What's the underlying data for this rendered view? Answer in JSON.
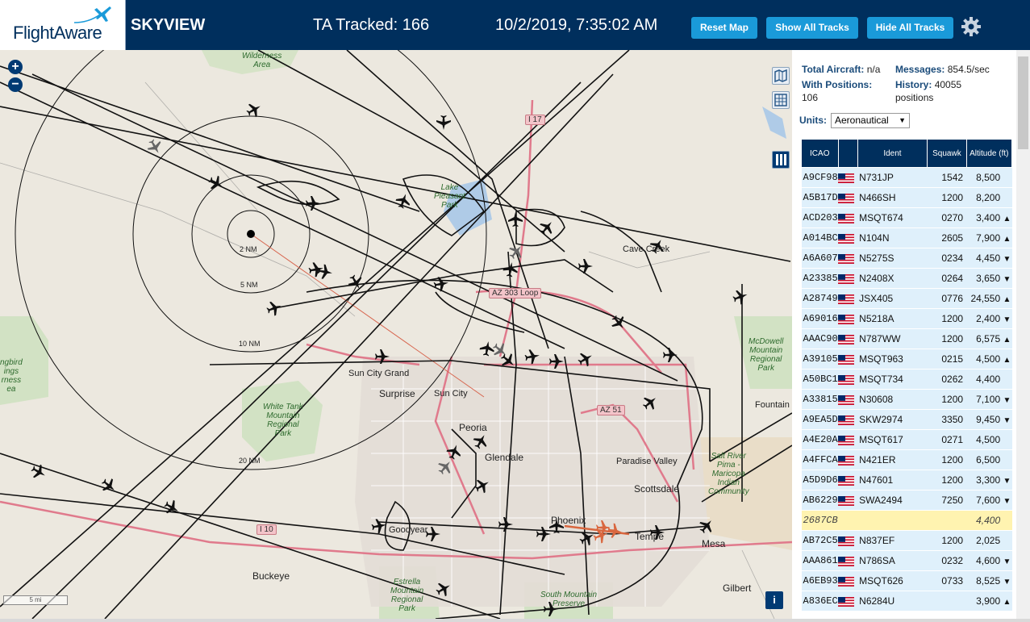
{
  "header": {
    "logo": "FlightAware",
    "app_title": "SKYVIEW",
    "ta_tracked": "TA Tracked: 166",
    "datetime": "10/2/2019, 7:35:02 AM",
    "buttons": {
      "reset": "Reset Map",
      "show_all": "Show All Tracks",
      "hide_all": "Hide All Tracks"
    },
    "settings_icon": "gear-icon"
  },
  "map": {
    "zoom_in": "+",
    "zoom_out": "−",
    "range_rings": [
      "2 NM",
      "5 NM",
      "10 NM",
      "20 NM"
    ],
    "labels": {
      "wilderness": "Wilderness\nArea",
      "cave_creek": "Cave Creek",
      "sun_city_grand": "Sun City Grand",
      "surprise": "Surprise",
      "sun_city": "Sun City",
      "peoria": "Peoria",
      "glendale": "Glendale",
      "paradise_valley": "Paradise Valley",
      "scottsdale": "Scottsdale",
      "phoenix": "Phoenix",
      "tempe": "Tempe",
      "mesa": "Mesa",
      "gilbert": "Gilbert",
      "goodyear": "Goodyear",
      "buckeye": "Buckeye",
      "fountain": "Fountain",
      "white_tank": "White Tank\nMountain\nRegional\nPark",
      "mcdowell": "McDowell\nMountain\nRegional\nPark",
      "estrella": "Estrella\nMountain\nRegional\nPark",
      "south_mountain": "South Mountain\nPreserve",
      "salt_river": "Salt River\nPima -\nMaricopa\nIndian\nCommunity",
      "left_edge": "ngbird\nings\nrness\nea",
      "lake_park": "Lake\nPleasant\nRegional\nPark"
    },
    "highways": {
      "i17": "I 17",
      "az303": "AZ 303 Loop",
      "az51": "AZ 51",
      "i10": "I 10"
    },
    "scale": "5 mi"
  },
  "panel": {
    "total_aircraft_label": "Total Aircraft:",
    "total_aircraft_value": "n/a",
    "with_positions_label": "With Positions:",
    "with_positions_value": "106",
    "messages_label": "Messages:",
    "messages_value": "854.5/sec",
    "history_label": "History:",
    "history_value": "40055 positions",
    "units_label": "Units:",
    "units_value": "Aeronautical",
    "columns": [
      "ICAO",
      "",
      "Ident",
      "Squawk",
      "Altitude (ft)"
    ]
  },
  "aircraft": [
    {
      "icao": "A9CF98",
      "ident": "N731JP",
      "squawk": "1542",
      "alt": "8,500",
      "trend": ""
    },
    {
      "icao": "A5B17D",
      "ident": "N466SH",
      "squawk": "1200",
      "alt": "8,200",
      "trend": ""
    },
    {
      "icao": "ACD203",
      "ident": "MSQT674",
      "squawk": "0270",
      "alt": "3,400",
      "trend": "▲"
    },
    {
      "icao": "A014BC",
      "ident": "N104N",
      "squawk": "2605",
      "alt": "7,900",
      "trend": "▲"
    },
    {
      "icao": "A6A607",
      "ident": "N5275S",
      "squawk": "0234",
      "alt": "4,450",
      "trend": "▼"
    },
    {
      "icao": "A23385",
      "ident": "N2408X",
      "squawk": "0264",
      "alt": "3,650",
      "trend": "▼"
    },
    {
      "icao": "A28749",
      "ident": "JSX405",
      "squawk": "0776",
      "alt": "24,550",
      "trend": "▲"
    },
    {
      "icao": "A69016",
      "ident": "N5218A",
      "squawk": "1200",
      "alt": "2,400",
      "trend": "▼"
    },
    {
      "icao": "AAAC90",
      "ident": "N787WW",
      "squawk": "1200",
      "alt": "6,575",
      "trend": "▲"
    },
    {
      "icao": "A39105",
      "ident": "MSQT963",
      "squawk": "0215",
      "alt": "4,500",
      "trend": "▲"
    },
    {
      "icao": "A50BC1",
      "ident": "MSQT734",
      "squawk": "0262",
      "alt": "4,400",
      "trend": ""
    },
    {
      "icao": "A33815",
      "ident": "N30608",
      "squawk": "1200",
      "alt": "7,100",
      "trend": "▼"
    },
    {
      "icao": "A9EA5D",
      "ident": "SKW2974",
      "squawk": "3350",
      "alt": "9,450",
      "trend": "▼"
    },
    {
      "icao": "A4E20A",
      "ident": "MSQT617",
      "squawk": "0271",
      "alt": "4,500",
      "trend": ""
    },
    {
      "icao": "A4FFCA",
      "ident": "N421ER",
      "squawk": "1200",
      "alt": "6,500",
      "trend": ""
    },
    {
      "icao": "A5D9D6",
      "ident": "N47601",
      "squawk": "1200",
      "alt": "3,300",
      "trend": "▼"
    },
    {
      "icao": "AB6229",
      "ident": "SWA2494",
      "squawk": "7250",
      "alt": "7,600",
      "trend": "▼"
    },
    {
      "icao": "2687CB",
      "ident": "",
      "squawk": "",
      "alt": "4,400",
      "trend": "",
      "highlight": true
    },
    {
      "icao": "AB72C5",
      "ident": "N837EF",
      "squawk": "1200",
      "alt": "2,025",
      "trend": ""
    },
    {
      "icao": "AAA861",
      "ident": "N786SA",
      "squawk": "0232",
      "alt": "4,600",
      "trend": "▼"
    },
    {
      "icao": "A6EB93",
      "ident": "MSQT626",
      "squawk": "0733",
      "alt": "8,525",
      "trend": "▼"
    },
    {
      "icao": "A836EC",
      "ident": "N6284U",
      "squawk": "",
      "alt": "3,900",
      "trend": "▲"
    }
  ],
  "colors": {
    "header_bg": "#002f5d",
    "button_bg": "#1a9ad9",
    "row_bg": "#dff0fb",
    "row_highlight": "#fff3b0",
    "map_bg": "#ece8df"
  }
}
